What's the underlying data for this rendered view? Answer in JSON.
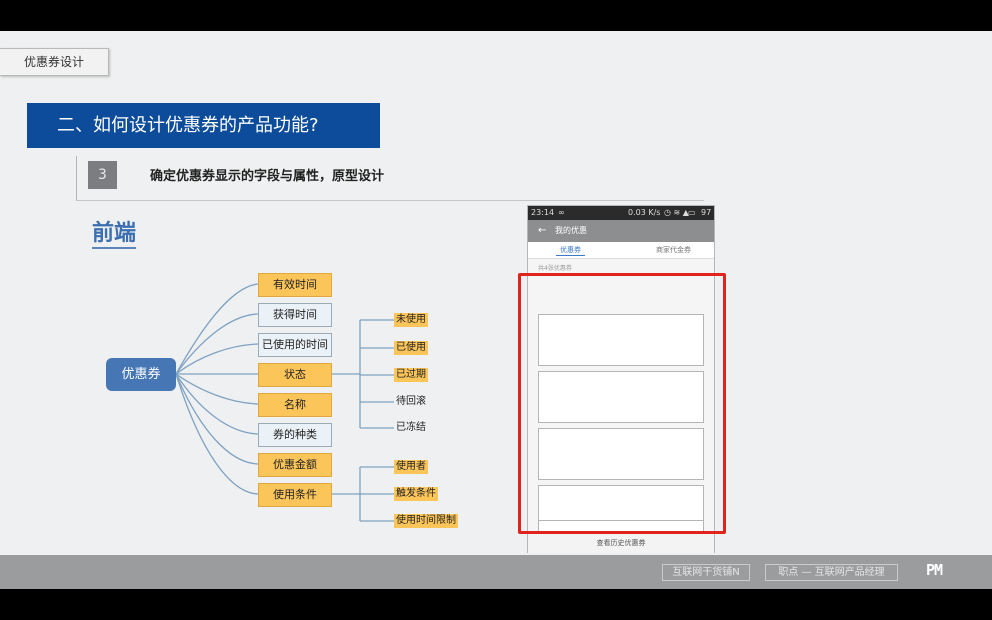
{
  "slide_tab": "优惠券设计",
  "title": "二、如何设计优惠券的产品功能?",
  "step": {
    "number": "3",
    "text": "确定优惠券显示的字段与属性，原型设计"
  },
  "section_title": "前端",
  "mindmap": {
    "root": "优惠券",
    "nodes": [
      {
        "label": "有效时间",
        "style": "yellow"
      },
      {
        "label": "获得时间",
        "style": "white"
      },
      {
        "label": "已使用的时间",
        "style": "white"
      },
      {
        "label": "状态",
        "style": "yellow"
      },
      {
        "label": "名称",
        "style": "yellow"
      },
      {
        "label": "券的种类",
        "style": "white"
      },
      {
        "label": "优惠金额",
        "style": "yellow"
      },
      {
        "label": "使用条件",
        "style": "yellow"
      }
    ],
    "status_children": [
      "未使用",
      "已使用",
      "已过期",
      "待回滚",
      "已冻结"
    ],
    "condition_children": [
      "使用者",
      "触发条件",
      "使用时间限制"
    ],
    "line_color": "#7fa2c2"
  },
  "phone": {
    "status_time": "23:14",
    "status_right": "0.03 K/s",
    "battery": "97",
    "title": "我的优惠",
    "tab1": "优惠券",
    "tab2": "商家代金券",
    "count_text": "共4张优惠券",
    "footer": "查看历史优惠券"
  },
  "bottom": {
    "badge1": "互联网干货铺N",
    "badge2": "职点 — 互联网产品经理",
    "logo": "PM"
  },
  "colors": {
    "banner": "#0d4c9a",
    "root": "#4677b4",
    "yellow": "#fcc55a",
    "highlight": "#e0241b"
  }
}
